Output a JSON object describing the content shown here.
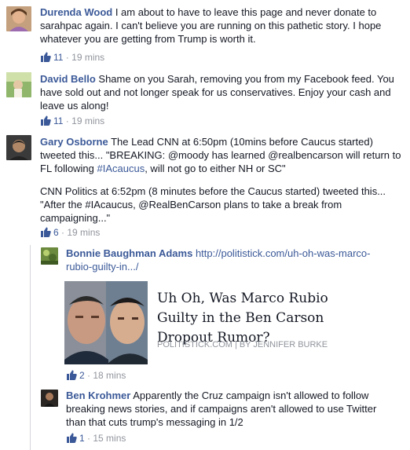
{
  "comments": [
    {
      "name": "Durenda Wood",
      "text": " I am about to have to leave this page and never donate to sarahpac again. I can't believe you are running on this pathetic story. I hope whatever you are getting from Trump is worth it.",
      "likes": "11",
      "time": "19 mins"
    },
    {
      "name": "David Bello",
      "text": " Shame on you Sarah, removing you from my Facebook feed. You have sold out and not longer speak for us conservatives. Enjoy your cash and leave us along!",
      "likes": "11",
      "time": "19 mins"
    },
    {
      "name": "Gary Osborne",
      "text_p1_a": " The Lead CNN at 6:50pm (10mins before Caucus started) tweeted this... \"BREAKING: @moody has learned @realbencarson will return to FL following ",
      "hashtag": "#IAcaucus",
      "text_p1_b": ", will not go to either NH or SC\"",
      "text_p2": "CNN Politics at 6:52pm (8 minutes before the Caucus started) tweeted this... \"After the #IAcaucus, @RealBenCarson plans to take a break from campaigning...\"",
      "likes": "6",
      "time": "19 mins"
    }
  ],
  "replies": [
    {
      "name": "Bonnie Baughman Adams",
      "link": "http://politistick.com/uh-oh-was-marco-rubio-guilty-in.../",
      "card": {
        "title": "Uh Oh, Was Marco Rubio Guilty in the Ben Carson Dropout Rumor?",
        "source": "POLITISTICK.COM",
        "separator": "|",
        "byline": "BY JENNIFER BURKE"
      },
      "likes": "2",
      "time": "18 mins"
    },
    {
      "name": "Ben Krohmer",
      "text": " Apparently the Cruz campaign isn't allowed to follow breaking news stories, and if campaigns aren't allowed to use Twitter than that cuts trump's messaging in 1/2",
      "likes": "1",
      "time": "15 mins"
    }
  ],
  "separator_dot": " · ",
  "icons": {
    "like": "thumbs-up-icon"
  },
  "colors": {
    "link": "#3b5998",
    "meta": "#90949c",
    "text": "#141823"
  }
}
